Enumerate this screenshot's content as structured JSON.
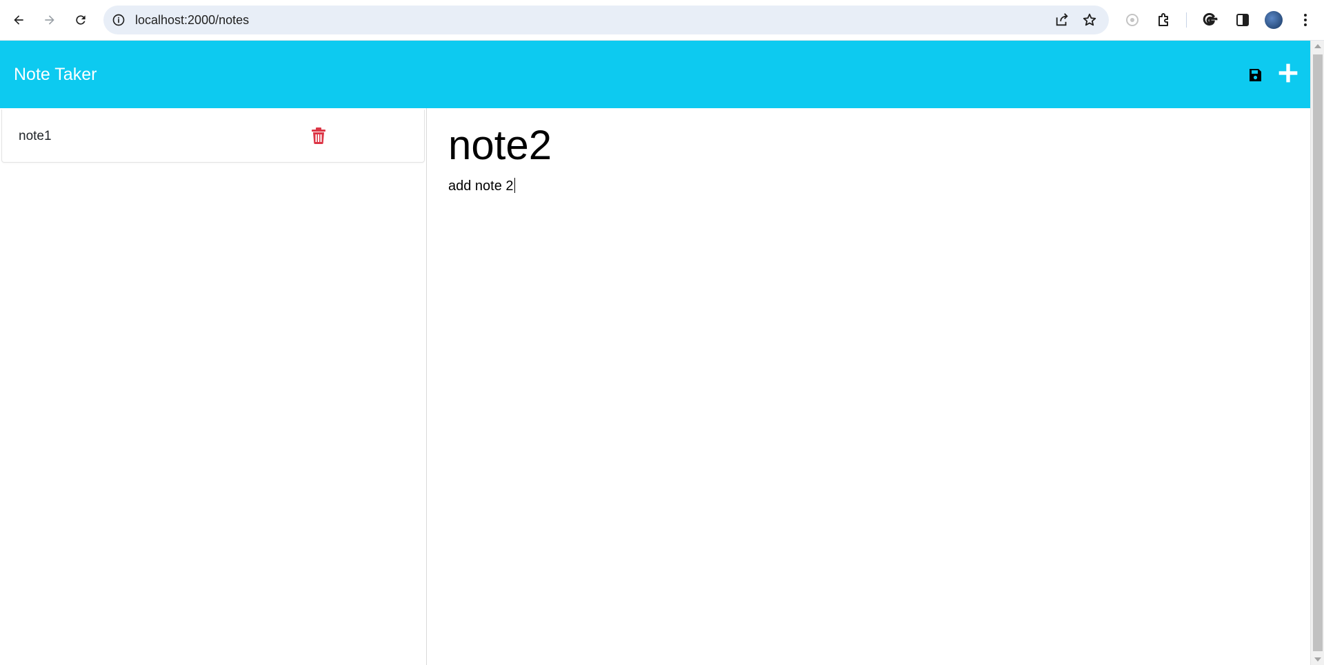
{
  "browser": {
    "url": "localhost:2000/notes",
    "icons": [
      "back-icon",
      "forward-icon",
      "reload-icon",
      "info-icon",
      "share-icon",
      "star-icon",
      "extension-icon",
      "puzzle-icon",
      "google-icon",
      "side-panel-icon",
      "avatar",
      "menu-icon"
    ]
  },
  "app": {
    "title": "Note Taker",
    "accent_color": "#0dcaf0",
    "delete_color": "#dc3545"
  },
  "sidebar": {
    "notes": [
      {
        "title": "note1"
      }
    ]
  },
  "editor": {
    "title": "note2",
    "text": "add note 2"
  }
}
